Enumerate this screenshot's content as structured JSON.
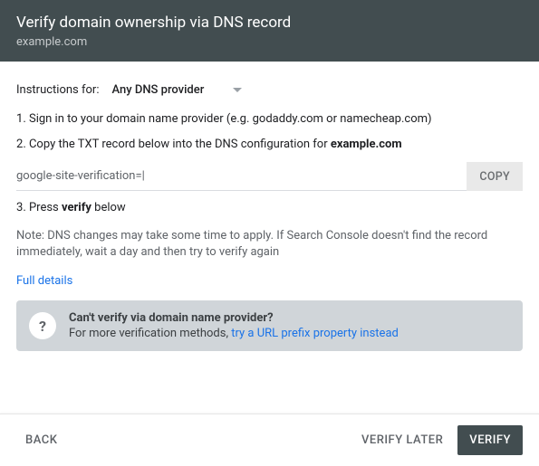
{
  "header": {
    "title": "Verify domain ownership via DNS record",
    "subtitle": "example.com"
  },
  "instructions": {
    "label": "Instructions for:",
    "provider": "Any DNS provider"
  },
  "steps": {
    "s1": "Sign in to your domain name provider (e.g. godaddy.com or namecheap.com)",
    "s2_prefix": "Copy the TXT record below into the DNS configuration for ",
    "s2_domain": "example.com",
    "s3_prefix": "Press ",
    "s3_bold": "verify",
    "s3_suffix": " below"
  },
  "txt": {
    "value": "google-site-verification=|",
    "copy_label": "COPY"
  },
  "note": "Note: DNS changes may take some time to apply. If Search Console doesn't find the record immediately, wait a day and then try to verify again",
  "full_details": "Full details",
  "help": {
    "icon": "?",
    "title": "Can't verify via domain name provider?",
    "sub_prefix": "For more verification methods, ",
    "sub_link": "try a URL prefix property instead"
  },
  "footer": {
    "back": "BACK",
    "later": "VERIFY LATER",
    "verify": "VERIFY"
  }
}
